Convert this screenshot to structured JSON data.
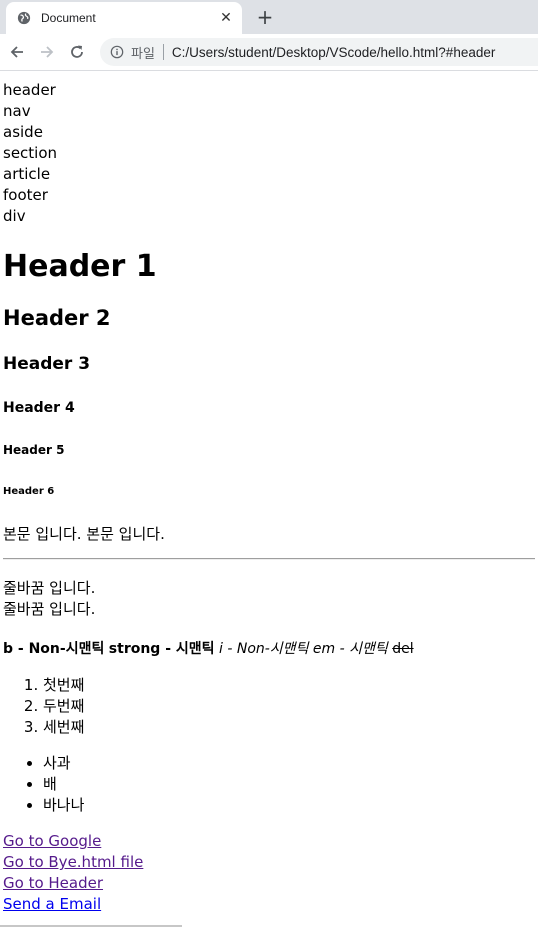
{
  "browser": {
    "tab_title": "Document",
    "close_glyph": "✕",
    "newtab_glyph": "+",
    "scheme_label": "파일",
    "url": "C:/Users/student/Desktop/VScode/hello.html?#header"
  },
  "tags": [
    "header",
    "nav",
    "aside",
    "section",
    "article",
    "footer",
    "div"
  ],
  "headings": {
    "h1": "Header 1",
    "h2": "Header 2",
    "h3": "Header 3",
    "h4": "Header 4",
    "h5": "Header 5",
    "h6": "Header 6"
  },
  "paragraph": "본문 입니다. 본문 입니다.",
  "line_breaks": [
    "줄바꿈 입니다.",
    "줄바꿈 입니다."
  ],
  "inline_semantics": {
    "b_text": "b - Non-시맨틱",
    "strong_text": "strong - 시맨틱",
    "i_text": "i - Non-시맨틱",
    "em_text": "em - 시맨틱",
    "del_text": "del"
  },
  "ordered_list": [
    "첫번째",
    "두번째",
    "세번째"
  ],
  "unordered_list": [
    "사과",
    "배",
    "바나나"
  ],
  "links": [
    "Go to Google",
    "Go to Bye.html file",
    "Go to Header",
    "Send a Email"
  ]
}
